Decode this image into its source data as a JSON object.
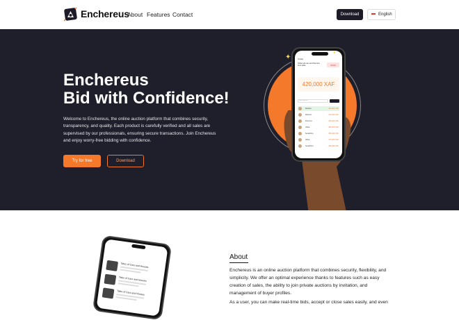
{
  "nav": {
    "brand": "Enchereus",
    "links": [
      "About",
      "Features",
      "Contact"
    ],
    "download": "Download",
    "language": "English"
  },
  "hero": {
    "title_line1": "Enchereus",
    "title_line2": "Bid with Confidence!",
    "description": "Welcome to Enchereus, the online auction platform that combines security, transparency, and quality. Each product is carefully verified and all sales are supervised by our professionals, ensuring secure transactions. Join Enchereus and enjoy worry-free bidding with confidence.",
    "try_button": "Try for free",
    "download_button": "Download",
    "accent_color": "#f5792b"
  },
  "phone": {
    "header": "Today",
    "item": "Tables all cars and Reorium front table",
    "badge": "00:00",
    "price": "420,000 XAF",
    "input_placeholder": "Enter amount",
    "bids": [
      {
        "name": "Daniela",
        "amount": "420,000 XAF"
      },
      {
        "name": "Roberto",
        "amount": "410,000 XAF"
      },
      {
        "name": "Florence",
        "amount": "400,000 XAF"
      },
      {
        "name": "Olivia",
        "amount": "390,000 XAF"
      },
      {
        "name": "Seraphina",
        "amount": "380,000 XAF"
      },
      {
        "name": "Olivia",
        "amount": "370,000 XAF"
      },
      {
        "name": "Seraphina",
        "amount": "360,000 XAF"
      }
    ]
  },
  "about_phone": {
    "items": [
      "Tales of Cars and Houses",
      "Tales of Cars and Houses",
      "Tales of Cars and Houses"
    ]
  },
  "about": {
    "heading": "About",
    "p1": "Enchereus is an online auction platform that combines security, flexibility, and simplicity. We offer an optimal experience thanks to features such as easy creation of sales, the ability to join private auctions by invitation, and management of buyer profiles.",
    "p2": "As a user, you can make real-time bids, accept or close sales easily, and even"
  }
}
